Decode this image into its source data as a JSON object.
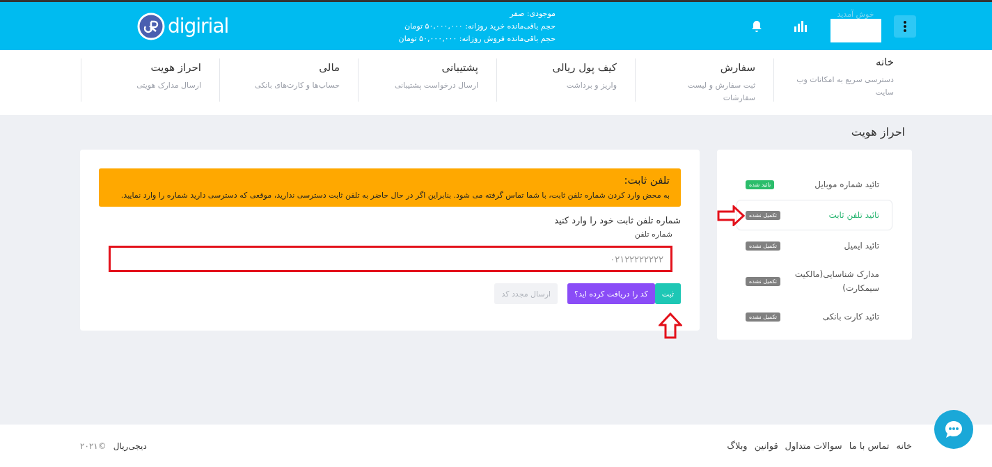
{
  "header": {
    "logo_text": "digirial",
    "balance": "موجودی: صفر",
    "buy_limit": "حجم باقی‌مانده خرید روزانه: ۵۰,۰۰۰,۰۰۰ تومان",
    "sell_limit": "حجم باقی‌مانده فروش روزانه: ۵۰,۰۰۰,۰۰۰ تومان",
    "welcome": "خوش آمدید"
  },
  "nav": [
    {
      "title": "خانه",
      "subtitle": "دسترسی سریع به امکانات وب سایت"
    },
    {
      "title": "سفارش",
      "subtitle": "ثبت سفارش و لیست سفارشات"
    },
    {
      "title": "کیف پول ریالی",
      "subtitle": "واریز و برداشت"
    },
    {
      "title": "پشتیبانی",
      "subtitle": "ارسال درخواست پشتیبانی"
    },
    {
      "title": "مالی",
      "subtitle": "حساب‌ها و کارت‌های بانکی"
    },
    {
      "title": "احراز هویت",
      "subtitle": "ارسال مدارک هویتی"
    }
  ],
  "page_title": "احراز هویت",
  "steps": [
    {
      "label": "تائید شماره موبایل",
      "badge": "تائید شده",
      "kind": "done",
      "selected": false
    },
    {
      "label": "تائید تلفن ثابت",
      "badge": "تکمیل نشده",
      "kind": "pending",
      "selected": true
    },
    {
      "label": "تائید ایمیل",
      "badge": "تکمیل نشده",
      "kind": "pending",
      "selected": false
    },
    {
      "label": "مدارک شناسایی(مالکیت سیمکارت)",
      "badge": "تکمیل نشده",
      "kind": "pending",
      "selected": false
    },
    {
      "label": "تائید کارت بانکی",
      "badge": "تکمیل نشده",
      "kind": "pending",
      "selected": false
    }
  ],
  "alert": {
    "title": "تلفن ثابت:",
    "text": "به محض وارد کردن شماره تلفن ثابت، با شما تماس گرفته می شود. بنابراین اگر در حال حاضر به تلفن ثابت دسترسی ندارید، موقعی که دسترسی دارید شماره را وارد نمایید."
  },
  "form": {
    "heading": "شماره تلفن ثابت خود را وارد کنید",
    "field_label": "شماره تلفن",
    "placeholder": "۰۲۱۲۲۲۲۲۲۲۲"
  },
  "buttons": [
    {
      "label": "ثبت",
      "kind": "primary",
      "disabled": false
    },
    {
      "label": "کد را دریافت کرده اید؟",
      "kind": "secondary",
      "disabled": false
    },
    {
      "label": "ارسال مجدد کد",
      "kind": "resend",
      "disabled": true
    }
  ],
  "footer": {
    "links": [
      "خانه",
      "تماس با ما",
      "سوالات متداول",
      "قوانین",
      "وبلاگ"
    ],
    "copyright": "©۲۰۲۱",
    "brand": "دیجی‌ریال"
  }
}
